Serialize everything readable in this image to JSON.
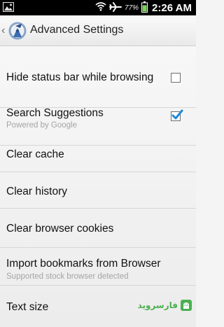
{
  "status_bar": {
    "battery_percent": "77%",
    "time": "2:26 AM",
    "icons": [
      "image-notification-icon",
      "wifi-icon",
      "airplane-mode-icon",
      "battery-icon"
    ]
  },
  "action_bar": {
    "title": "Advanced Settings",
    "icons": [
      "up-caret-icon",
      "app-icon"
    ]
  },
  "settings": {
    "items": [
      {
        "label": "Hide status bar while browsing",
        "checkbox": true,
        "checked": false
      },
      {
        "label": "Search Suggestions",
        "summary": "Powered by Google",
        "checkbox": true,
        "checked": true
      },
      {
        "label": "Clear cache"
      },
      {
        "label": "Clear history"
      },
      {
        "label": "Clear browser cookies"
      },
      {
        "label": "Import bookmarks from Browser",
        "summary": "Supported stock browser detected"
      },
      {
        "label": "Text size"
      }
    ]
  },
  "watermark": {
    "text": "فارسروید"
  },
  "colors": {
    "accent_check": "#1e88d6",
    "watermark_green": "#4caf50",
    "statusbar_bg": "#000000"
  }
}
